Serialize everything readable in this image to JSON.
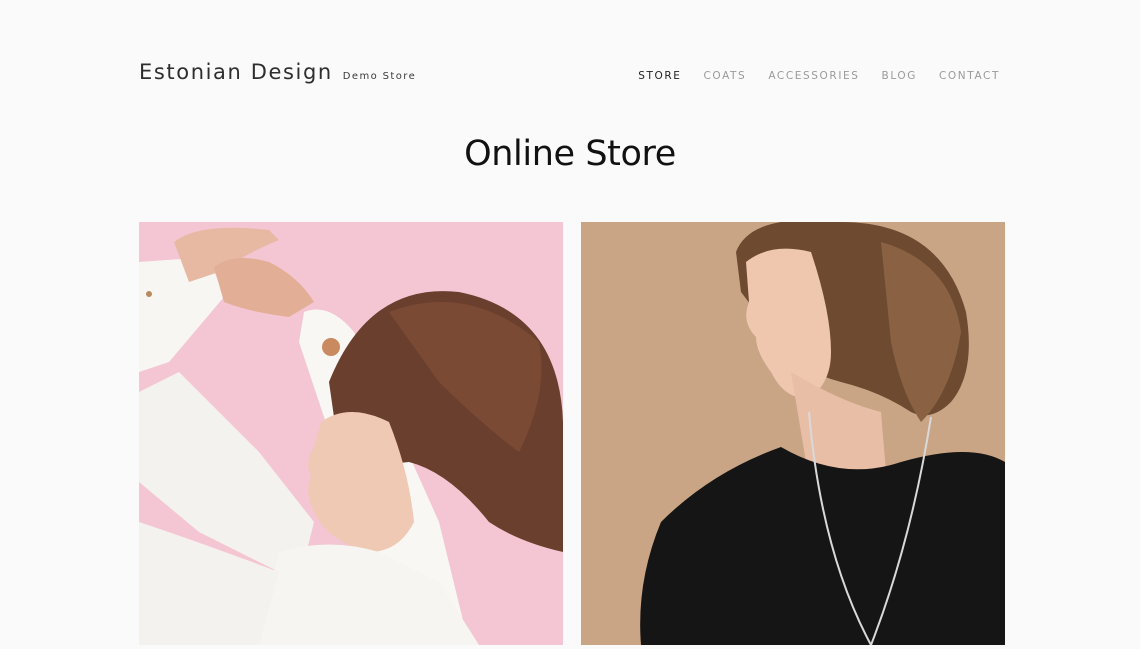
{
  "brand": {
    "title": "Estonian Design",
    "subtitle": "Demo Store"
  },
  "nav": {
    "items": [
      {
        "label": "STORE",
        "active": true
      },
      {
        "label": "COATS",
        "active": false
      },
      {
        "label": "ACCESSORIES",
        "active": false
      },
      {
        "label": "BLOG",
        "active": false
      },
      {
        "label": "CONTACT",
        "active": false
      }
    ]
  },
  "main": {
    "title": "Online Store"
  },
  "products": [
    {
      "image_name": "woman-white-shirt-pink-background-photo",
      "background_color": "#f4c6d3",
      "garment_color": "#f7f6f2"
    },
    {
      "image_name": "woman-black-top-necklace-photo",
      "background_color": "#c9a586",
      "garment_color": "#151515"
    }
  ]
}
